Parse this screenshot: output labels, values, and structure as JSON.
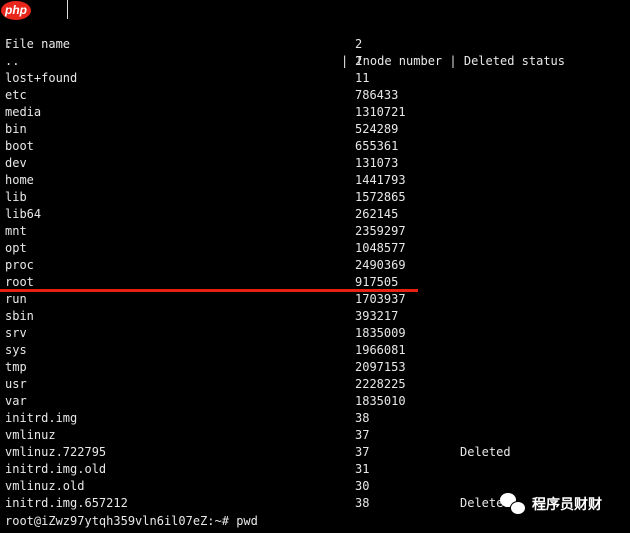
{
  "header": {
    "file_name": "File name",
    "sep1": "| ",
    "inode": "Inode number",
    "sep2": " | ",
    "deleted": "Deleted status"
  },
  "rows": [
    {
      "name": ".",
      "inode": "2",
      "status": ""
    },
    {
      "name": "..",
      "inode": "2",
      "status": ""
    },
    {
      "name": "lost+found",
      "inode": "11",
      "status": ""
    },
    {
      "name": "etc",
      "inode": "786433",
      "status": ""
    },
    {
      "name": "media",
      "inode": "1310721",
      "status": ""
    },
    {
      "name": "bin",
      "inode": "524289",
      "status": ""
    },
    {
      "name": "boot",
      "inode": "655361",
      "status": ""
    },
    {
      "name": "dev",
      "inode": "131073",
      "status": ""
    },
    {
      "name": "home",
      "inode": "1441793",
      "status": ""
    },
    {
      "name": "lib",
      "inode": "1572865",
      "status": ""
    },
    {
      "name": "lib64",
      "inode": "262145",
      "status": ""
    },
    {
      "name": "mnt",
      "inode": "2359297",
      "status": ""
    },
    {
      "name": "opt",
      "inode": "1048577",
      "status": ""
    },
    {
      "name": "proc",
      "inode": "2490369",
      "status": ""
    },
    {
      "name": "root",
      "inode": "917505",
      "status": ""
    },
    {
      "name": "run",
      "inode": "1703937",
      "status": ""
    },
    {
      "name": "sbin",
      "inode": "393217",
      "status": ""
    },
    {
      "name": "srv",
      "inode": "1835009",
      "status": ""
    },
    {
      "name": "sys",
      "inode": "1966081",
      "status": ""
    },
    {
      "name": "tmp",
      "inode": "2097153",
      "status": ""
    },
    {
      "name": "usr",
      "inode": "2228225",
      "status": ""
    },
    {
      "name": "var",
      "inode": "1835010",
      "status": ""
    },
    {
      "name": "initrd.img",
      "inode": "38",
      "status": ""
    },
    {
      "name": "vmlinuz",
      "inode": "37",
      "status": ""
    },
    {
      "name": "vmlinuz.722795",
      "inode": "37",
      "status": "Deleted"
    },
    {
      "name": "initrd.img.old",
      "inode": "31",
      "status": ""
    },
    {
      "name": "vmlinuz.old",
      "inode": "30",
      "status": ""
    },
    {
      "name": "initrd.img.657212",
      "inode": "38",
      "status": "Deleted"
    }
  ],
  "prompt": "root@iZwz97ytqh359vln6il07eZ:~# pwd",
  "logo": "php",
  "watermark": "程序员财财",
  "colors": {
    "highlight": "#e8200f",
    "background": "#000000"
  }
}
